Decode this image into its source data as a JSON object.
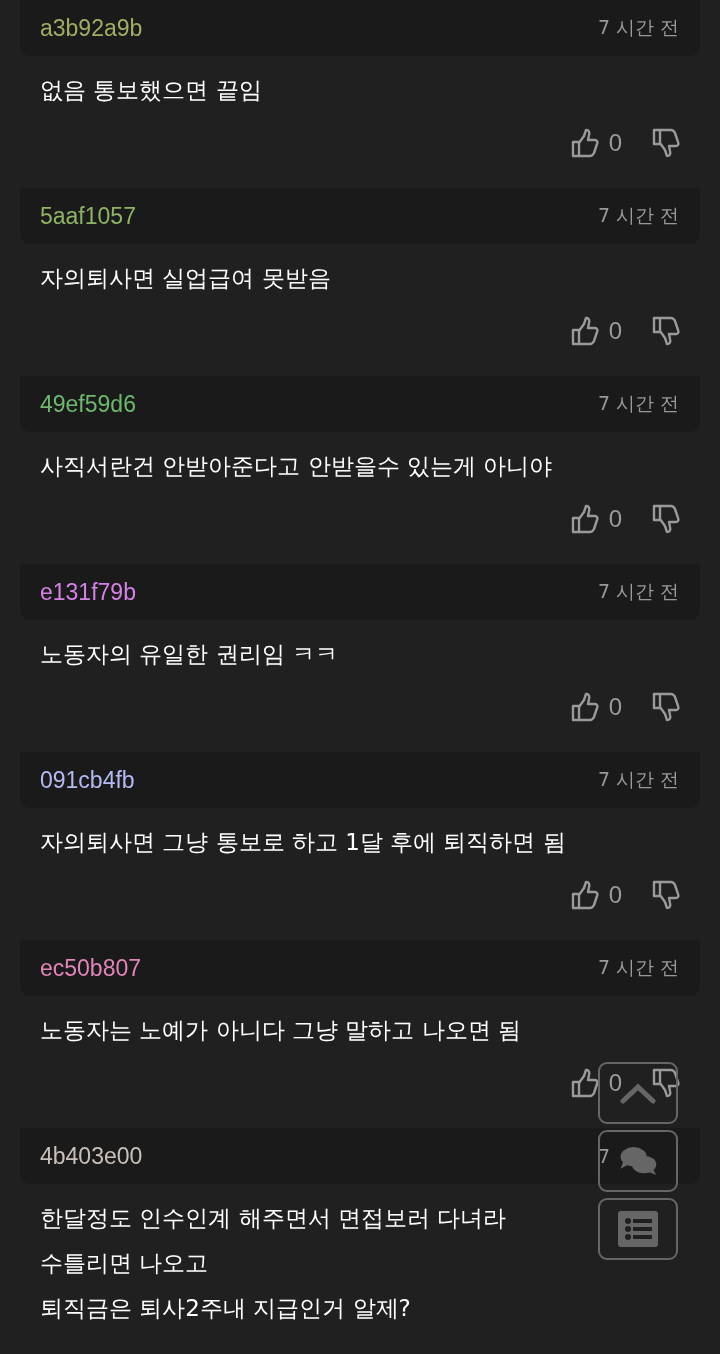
{
  "comments": [
    {
      "author": "a3b92a9b",
      "color": "#a3ad62",
      "time": "7 시간 전",
      "lines": [
        "없음 통보했으면 끝임"
      ],
      "likes": "0"
    },
    {
      "author": "5aaf1057",
      "color": "#8eb464",
      "time": "7 시간 전",
      "lines": [
        "자의퇴사면 실업급여 못받음"
      ],
      "likes": "0"
    },
    {
      "author": "49ef59d6",
      "color": "#6db86d",
      "time": "7 시간 전",
      "lines": [
        "사직서란건 안받아준다고 안받을수 있는게 아니야"
      ],
      "likes": "0"
    },
    {
      "author": "e131f79b",
      "color": "#d582e6",
      "time": "7 시간 전",
      "lines": [
        "노동자의 유일한 권리임 ㅋㅋ"
      ],
      "likes": "0"
    },
    {
      "author": "091cb4fb",
      "color": "#b4baf2",
      "time": "7 시간 전",
      "lines": [
        "자의퇴사면 그냥 통보로 하고 1달 후에 퇴직하면 됨"
      ],
      "likes": "0"
    },
    {
      "author": "ec50b807",
      "color": "#e285b8",
      "time": "7 시간 전",
      "lines": [
        "노동자는 노예가 아니다 그냥 말하고 나오면 됨"
      ],
      "likes": "0"
    },
    {
      "author": "4b403e00",
      "color": "#c9c1b9",
      "time": "7",
      "lines": [
        "한달정도 인수인계 해주면서 면접보러 다녀라",
        "수틀리면 나오고",
        "퇴직금은 퇴사2주내 지급인거 알제?"
      ]
    }
  ]
}
